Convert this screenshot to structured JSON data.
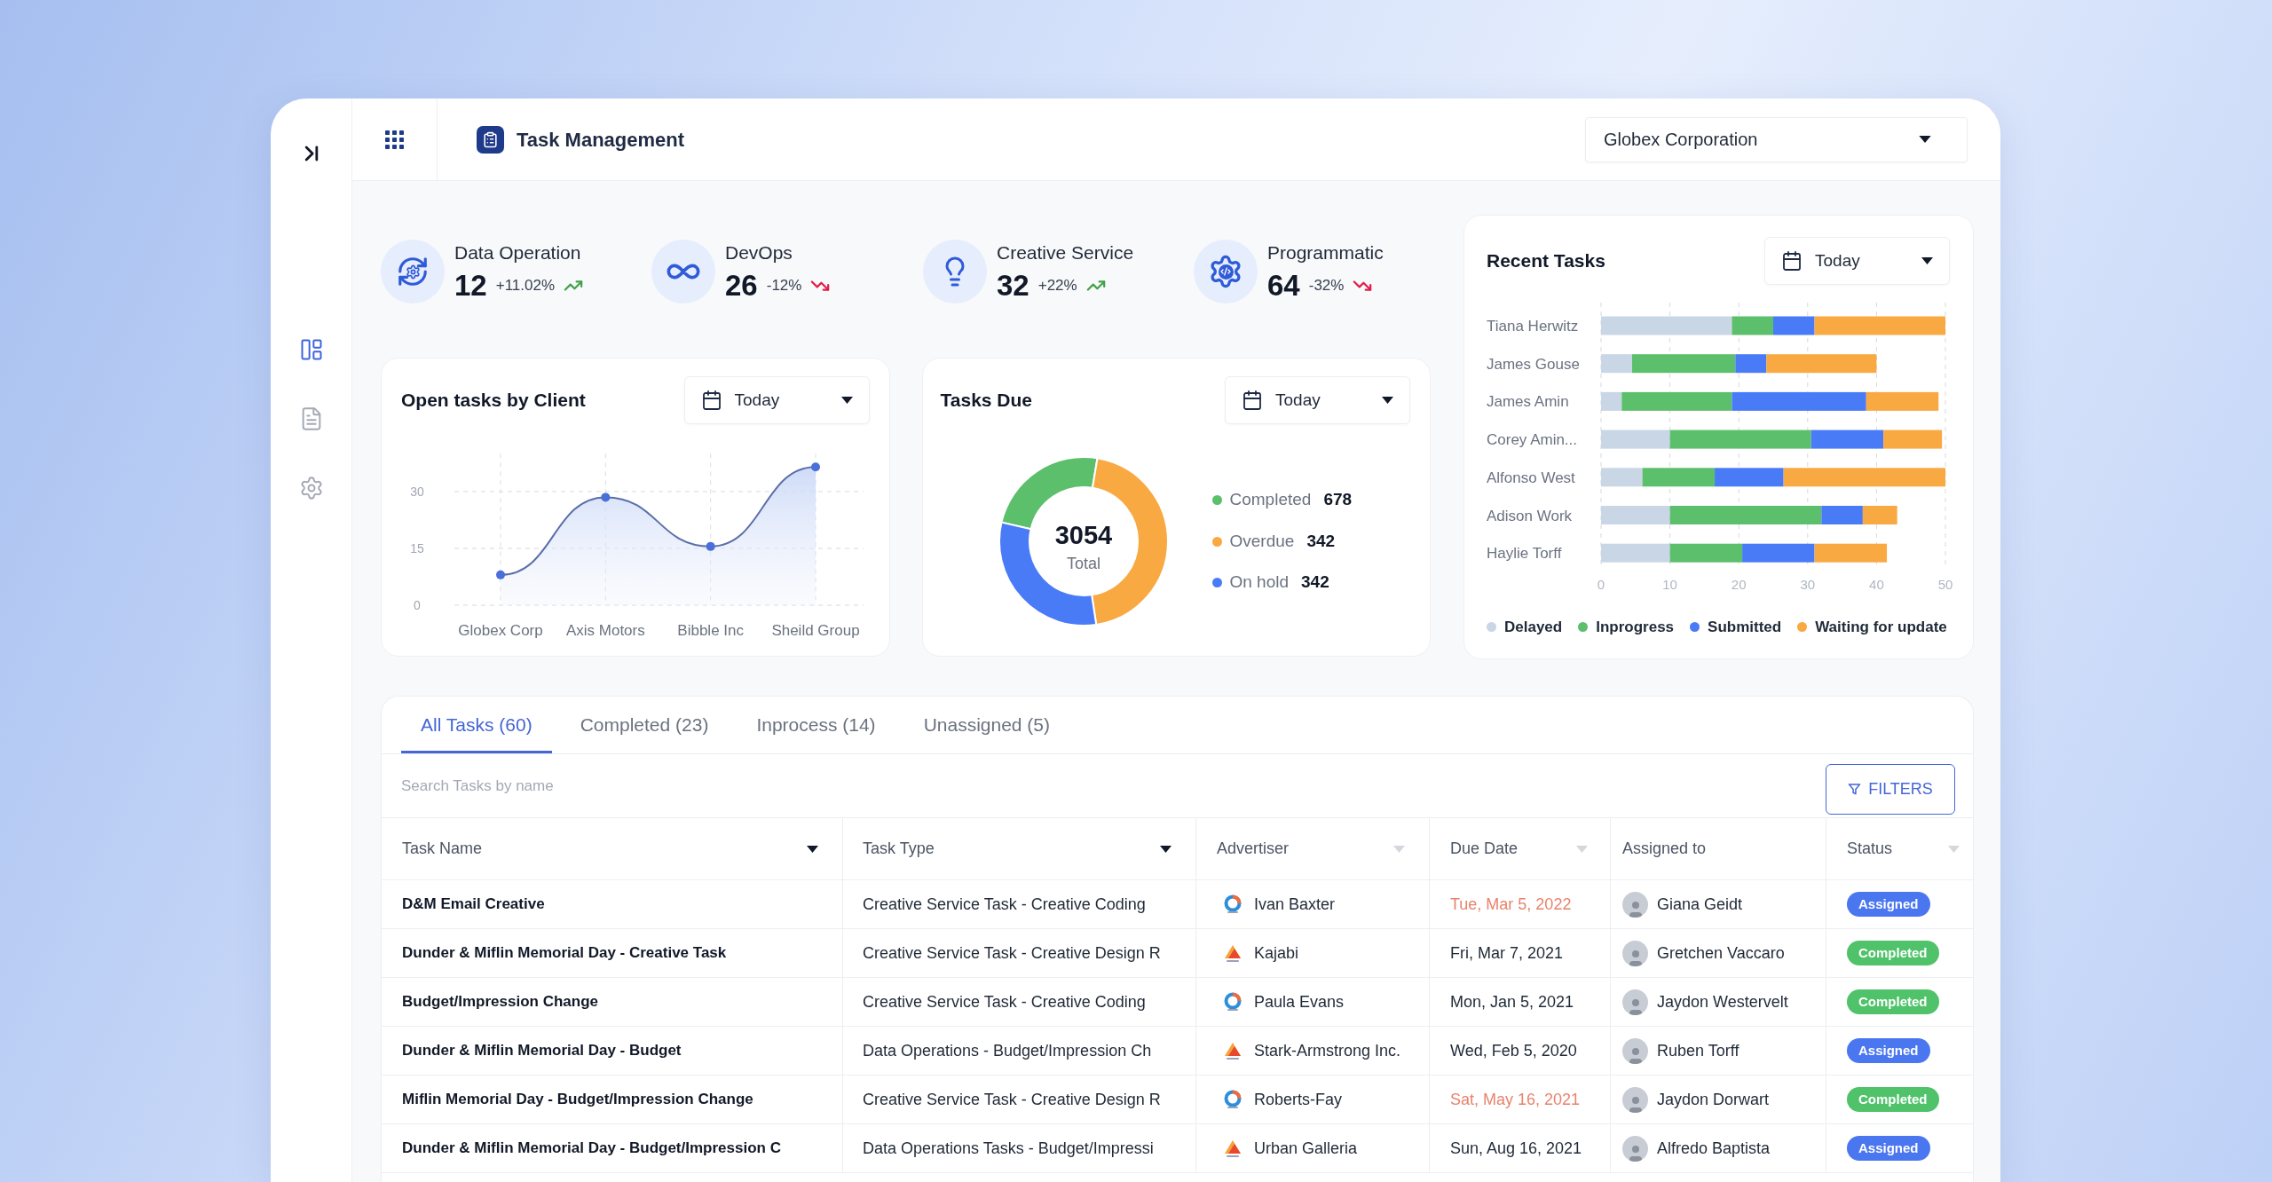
{
  "sidebar": {
    "items": [
      {
        "selected": true
      },
      {
        "selected": false
      },
      {
        "selected": false
      }
    ]
  },
  "header": {
    "title": "Task Management",
    "organization": "Globex Corporation"
  },
  "stats": [
    {
      "label": "Data Operation",
      "value": "12",
      "change": "+11.02%",
      "rising": true
    },
    {
      "label": "DevOps",
      "value": "26",
      "change": "-12%",
      "rising": false
    },
    {
      "label": "Creative Service",
      "value": "32",
      "change": "+22%",
      "rising": true
    },
    {
      "label": "Programmatic",
      "value": "64",
      "change": "-32%",
      "rising": false
    }
  ],
  "open_tasks": {
    "title": "Open tasks by Client",
    "period": "Today",
    "chart_data": {
      "type": "area",
      "categories": [
        "Globex Corp",
        "Axis Motors",
        "Bibble Inc",
        "Sheild Group"
      ],
      "series": [
        {
          "values": [
            8,
            28.5,
            15.5,
            36.5
          ]
        }
      ],
      "ylim": [
        0,
        40
      ],
      "yticks": [
        0,
        15,
        30
      ],
      "grid": true
    }
  },
  "tasks_due": {
    "title": "Tasks Due",
    "period": "Today",
    "total": "3054",
    "total_label": "Total",
    "legend": [
      {
        "label": "Completed",
        "value": "678",
        "color": "#5cbf6c"
      },
      {
        "label": "Overdue",
        "value": "342",
        "color": "#f9a942"
      },
      {
        "label": "On hold",
        "value": "342",
        "color": "#4a7bf7"
      }
    ]
  },
  "recent_tasks": {
    "title": "Recent Tasks",
    "period": "Today",
    "chart_data": {
      "type": "bar",
      "orientation": "horizontal",
      "stacked": true,
      "grid": true,
      "categories": [
        "Tiana Herwitz",
        "James Gouse",
        "James Amin",
        "Corey Amin...",
        "Alfonso West",
        "Adison Work",
        "Haylie Torff"
      ],
      "series": [
        {
          "name": "Delayed",
          "color": "#c9d6e6",
          "values": [
            19,
            4.5,
            3,
            10,
            6,
            10,
            10
          ]
        },
        {
          "name": "Inprogress",
          "color": "#5cbf6c",
          "values": [
            6,
            15,
            16,
            20.5,
            10.5,
            22,
            10.5
          ]
        },
        {
          "name": "Submitted",
          "color": "#4a7bf7",
          "values": [
            6,
            4.5,
            19.5,
            10.5,
            10,
            6,
            10.5
          ]
        },
        {
          "name": "Waiting for update",
          "color": "#f9a942",
          "values": [
            19,
            16,
            10.5,
            8.5,
            23.5,
            5,
            10.5
          ]
        }
      ],
      "xlim": [
        0,
        50
      ],
      "xticks": [
        0,
        10,
        20,
        30,
        40,
        50
      ]
    }
  },
  "tasks_table": {
    "tabs": [
      {
        "label": "All Tasks (60)",
        "selected": true
      },
      {
        "label": "Completed (23)",
        "selected": false
      },
      {
        "label": "Inprocess (14)",
        "selected": false
      },
      {
        "label": "Unassigned (5)",
        "selected": false
      }
    ],
    "search": {
      "placeholder": "Search Tasks by name"
    },
    "filter_button": "FILTERS",
    "columns": [
      {
        "label": "Task Name",
        "sortable": true,
        "sorted": true
      },
      {
        "label": "Task Type",
        "sortable": true,
        "sorted": true
      },
      {
        "label": "Advertiser",
        "sortable": true,
        "sorted": false
      },
      {
        "label": "Due Date",
        "sortable": true,
        "sorted": false
      },
      {
        "label": "Assigned to",
        "sortable": false,
        "sorted": false
      },
      {
        "label": "Status",
        "sortable": true,
        "sorted": false
      }
    ],
    "rows": [
      {
        "task_name": "D&M Email Creative",
        "task_type": "Creative Service Task - Creative Coding",
        "advertiser": {
          "name": "Ivan Baxter",
          "kind": "ring"
        },
        "due_date": "Tue, Mar 5, 2022",
        "overdue": true,
        "assignee": "Giana Geidt",
        "status": {
          "label": "Assigned",
          "color": "#4a76f0"
        }
      },
      {
        "task_name": "Dunder & Miflin Memorial Day - Creative Task",
        "task_type": "Creative Service Task - Creative Design R",
        "advertiser": {
          "name": "Kajabi",
          "kind": "peak"
        },
        "due_date": "Fri, Mar 7, 2021",
        "overdue": false,
        "assignee": "Gretchen Vaccaro",
        "status": {
          "label": "Completed",
          "color": "#4fc26a"
        }
      },
      {
        "task_name": "Budget/Impression Change",
        "task_type": "Creative Service Task - Creative Coding",
        "advertiser": {
          "name": "Paula Evans",
          "kind": "ring"
        },
        "due_date": "Mon, Jan 5, 2021",
        "overdue": false,
        "assignee": "Jaydon Westervelt",
        "status": {
          "label": "Completed",
          "color": "#4fc26a"
        }
      },
      {
        "task_name": "Dunder & Miflin Memorial Day - Budget",
        "task_type": "Data Operations - Budget/Impression Ch",
        "advertiser": {
          "name": "Stark-Armstrong Inc.",
          "kind": "peak"
        },
        "due_date": "Wed, Feb 5, 2020",
        "overdue": false,
        "assignee": "Ruben Torff",
        "status": {
          "label": "Assigned",
          "color": "#4a76f0"
        }
      },
      {
        "task_name": "Miflin Memorial Day - Budget/Impression Change",
        "task_type": "Creative Service Task - Creative Design R",
        "advertiser": {
          "name": "Roberts-Fay",
          "kind": "ring"
        },
        "due_date": "Sat, May 16, 2021",
        "overdue": true,
        "assignee": "Jaydon Dorwart",
        "status": {
          "label": "Completed",
          "color": "#4fc26a"
        }
      },
      {
        "task_name": "Dunder & Miflin Memorial Day - Budget/Impression C",
        "task_type": "Data Operations Tasks - Budget/Impressi",
        "advertiser": {
          "name": "Urban Galleria",
          "kind": "peak"
        },
        "due_date": "Sun, Aug 16, 2021",
        "overdue": false,
        "assignee": "Alfredo Baptista",
        "status": {
          "label": "Assigned",
          "color": "#4a76f0"
        }
      }
    ]
  }
}
